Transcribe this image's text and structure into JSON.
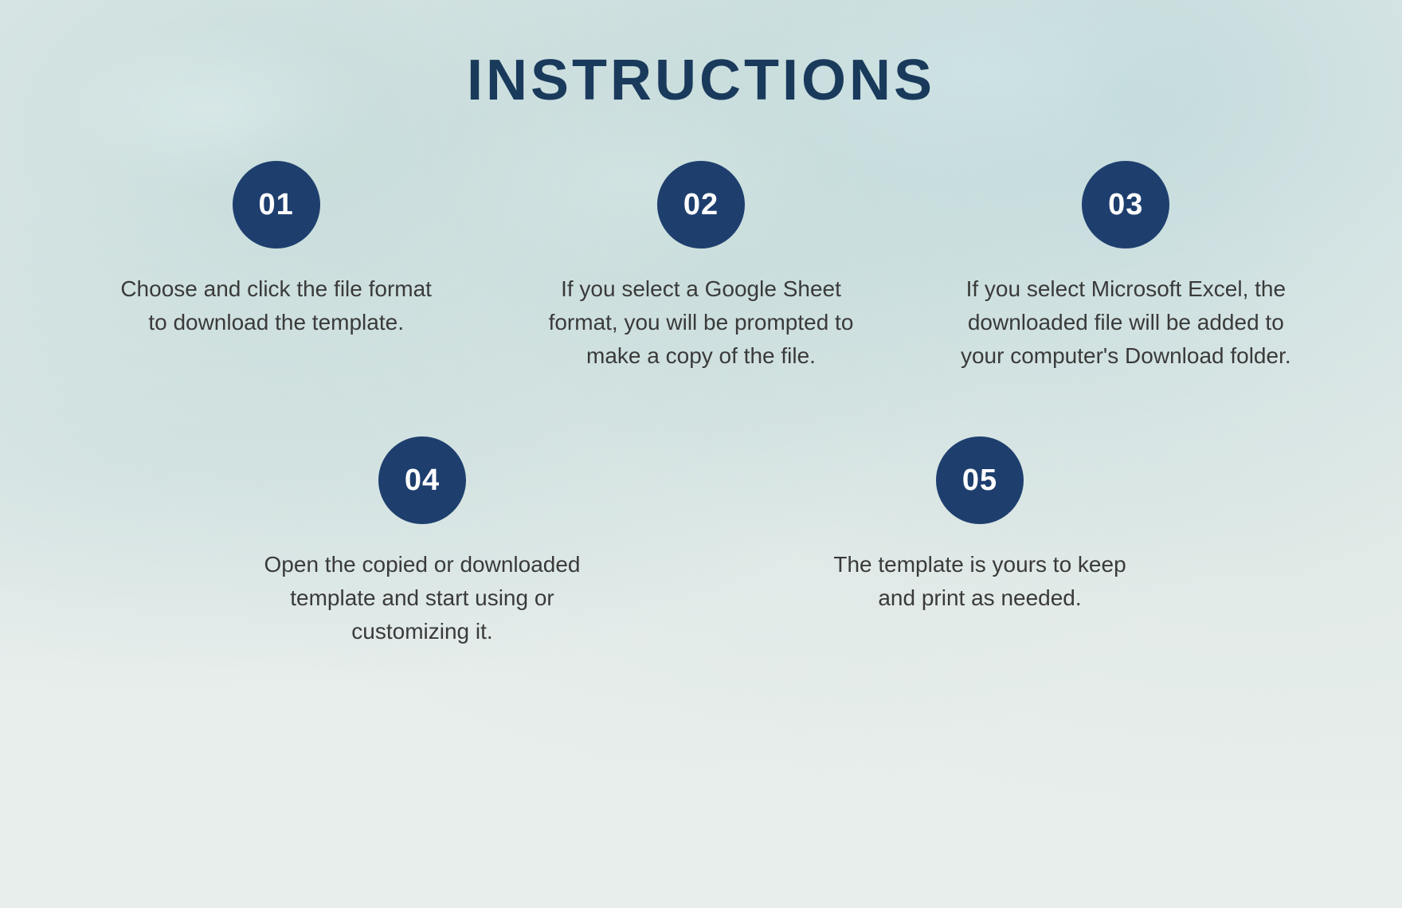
{
  "page": {
    "title": "INSTRUCTIONS",
    "background_color": "#e8eeec",
    "accent_color": "#1e3f6e"
  },
  "steps": [
    {
      "id": "step-01",
      "number": "01",
      "text": "Choose and click the file format to download the template."
    },
    {
      "id": "step-02",
      "number": "02",
      "text": "If you select a Google Sheet format, you will be prompted to make a copy of the file."
    },
    {
      "id": "step-03",
      "number": "03",
      "text": "If you select Microsoft Excel, the downloaded file will be added to your computer's Download  folder."
    },
    {
      "id": "step-04",
      "number": "04",
      "text": "Open the copied or downloaded template and start using or customizing it."
    },
    {
      "id": "step-05",
      "number": "05",
      "text": "The template is yours to keep and print as needed."
    }
  ]
}
